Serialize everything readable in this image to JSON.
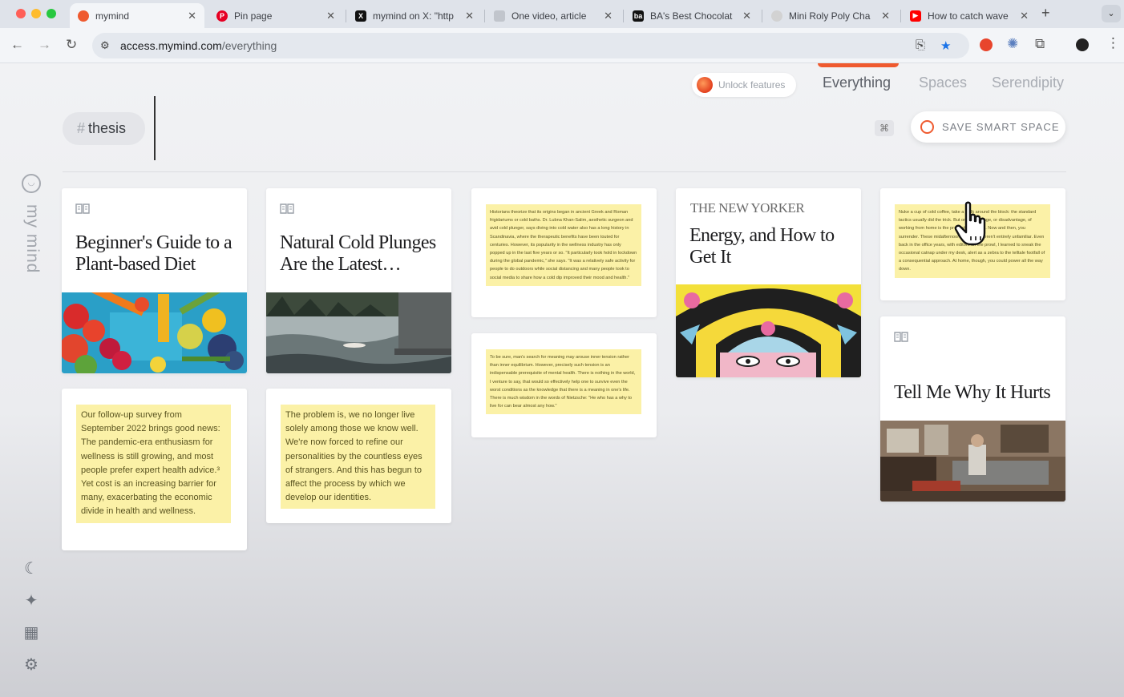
{
  "browser": {
    "tabs": [
      {
        "label": "mymind",
        "active": true,
        "favicon": "mymind-flame-icon",
        "color": "#ef5a2f"
      },
      {
        "label": "Pin page",
        "favicon": "pinterest-icon",
        "color": "#e60023"
      },
      {
        "label": "mymind on X: \"http",
        "favicon": "x-icon",
        "color": "#111111"
      },
      {
        "label": "One video, article",
        "favicon": "puzzle-icon",
        "color": "#9aa0a6"
      },
      {
        "label": "BA's Best Chocolat",
        "favicon": "ba-icon",
        "color": "#111111"
      },
      {
        "label": "Mini Roly Poly Cha",
        "favicon": "globe-icon",
        "color": "#c9c9c9"
      },
      {
        "label": "How to catch wave",
        "favicon": "youtube-icon",
        "color": "#ff0000"
      }
    ],
    "url_host": "access.mymind.com",
    "url_path": "/everything"
  },
  "app": {
    "unlock_label": "Unlock features",
    "nav": {
      "everything": "Everything",
      "spaces": "Spaces",
      "serendipity": "Serendipity"
    },
    "accent": "#ef5a2f",
    "tag_hash": "#",
    "tag_label": "thesis",
    "kbd_symbol": "⌘",
    "save_label": "SAVE SMART SPACE",
    "brand": "my mind"
  },
  "cards": {
    "diet_title": "Beginner's Guide to a Plant-based Diet",
    "plunge_title": "Natural Cold Plunges Are the Latest…",
    "survey_quote": "Our follow-up survey from September 2022 brings good news: The pandemic-era enthusiasm for wellness is still growing, and most people prefer expert health advice.³ Yet cost is an increasing barrier for many, exacerbating the economic divide in health and wellness.",
    "identity_quote": "The problem is, we no longer live solely among those we know well. We're now forced to refine our personalities by the countless eyes of strangers. And this has begun to affect the process by which we develop our identities.",
    "history_quote": "Historians theorize that its origins began in ancient Greek and Roman frigidariums or cold baths. Dr. Lubna Khan-Salim, aesthetic surgeon and avid cold plunger, says diving into cold water also has a long history in Scandinavia, where the therapeutic benefits have been touted for centuries. However, its popularity in the wellness industry has only popped up in the last five years or so. \"It particularly took hold in lockdown during the global pandemic,\" she says. \"It was a relatively safe activity for people to do outdoors while social distancing and many people took to social media to share how a cold dip improved their mood and health.\"",
    "meaning_quote": "To be sure, man's search for meaning may arouse inner tension rather than inner equilibrium. However, precisely such tension is an indispensable prerequisite of mental health. There is nothing in the world, I venture to say, that would so effectively help one to survive even the worst conditions as the knowledge that there is a meaning in one's life. There is much wisdom in the words of Nietzsche: \"He who has a why to live for can bear almost any how.\"",
    "newyorker_logo": "THE NEW YORKER",
    "energy_title": "Energy, and How to Get It",
    "coffee_quote": "Nuke a cup of cold coffee, take a walk around the block: the standard tactics usually did the trick. But one advantage, or disadvantage, of working from home is the proximity of a bed. Now and then, you surrender. These midafternoon doldrums weren't entirely unfamiliar. Even back in the office years, with editors on the prowl, I learned to sneak the occasional catnap under my desk, alert as a zebra to the telltale footfall of a consequential approach. At home, though, you could power all the way down.",
    "hurts_title": "Tell Me Why It Hurts"
  }
}
